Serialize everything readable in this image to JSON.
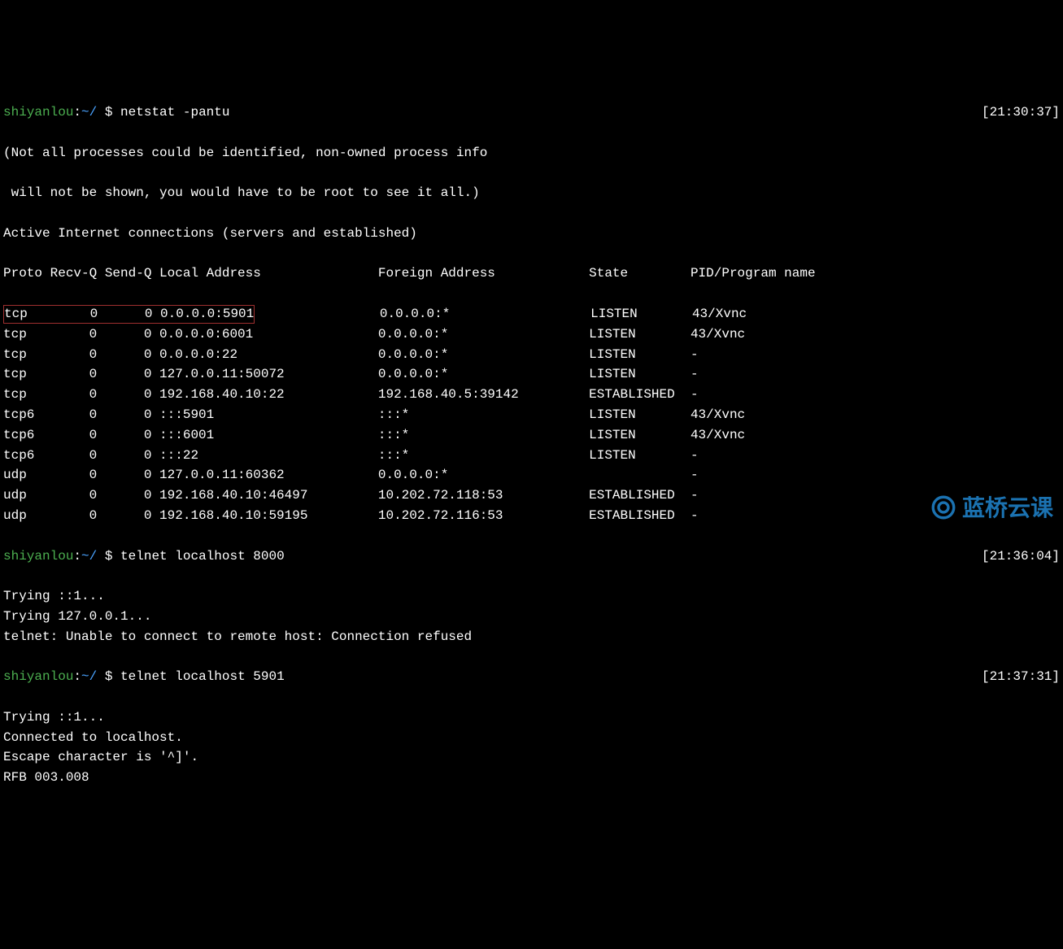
{
  "prompt1": {
    "user": "shiyanlou",
    "sep1": ":",
    "path": "~/",
    "dollar": " $ ",
    "command": "netstat -pantu",
    "timestamp": "[21:30:37]"
  },
  "warning_line1": "(Not all processes could be identified, non-owned process info",
  "warning_line2": " will not be shown, you would have to be root to see it all.)",
  "active_conn": "Active Internet connections (servers and established)",
  "header": {
    "proto": "Proto",
    "recvq": "Recv-Q",
    "sendq": "Send-Q",
    "local": "Local Address",
    "foreign": "Foreign Address",
    "state": "State",
    "pid": "PID/Program name"
  },
  "rows": [
    {
      "proto": "tcp",
      "recvq": "0",
      "sendq": "0",
      "local": "0.0.0.0:5901",
      "foreign": "0.0.0.0:*",
      "state": "LISTEN",
      "pid": "43/Xvnc",
      "highlight": true
    },
    {
      "proto": "tcp",
      "recvq": "0",
      "sendq": "0",
      "local": "0.0.0.0:6001",
      "foreign": "0.0.0.0:*",
      "state": "LISTEN",
      "pid": "43/Xvnc"
    },
    {
      "proto": "tcp",
      "recvq": "0",
      "sendq": "0",
      "local": "0.0.0.0:22",
      "foreign": "0.0.0.0:*",
      "state": "LISTEN",
      "pid": "-"
    },
    {
      "proto": "tcp",
      "recvq": "0",
      "sendq": "0",
      "local": "127.0.0.11:50072",
      "foreign": "0.0.0.0:*",
      "state": "LISTEN",
      "pid": "-"
    },
    {
      "proto": "tcp",
      "recvq": "0",
      "sendq": "0",
      "local": "192.168.40.10:22",
      "foreign": "192.168.40.5:39142",
      "state": "ESTABLISHED",
      "pid": "-"
    },
    {
      "proto": "tcp6",
      "recvq": "0",
      "sendq": "0",
      "local": ":::5901",
      "foreign": ":::*",
      "state": "LISTEN",
      "pid": "43/Xvnc"
    },
    {
      "proto": "tcp6",
      "recvq": "0",
      "sendq": "0",
      "local": ":::6001",
      "foreign": ":::*",
      "state": "LISTEN",
      "pid": "43/Xvnc"
    },
    {
      "proto": "tcp6",
      "recvq": "0",
      "sendq": "0",
      "local": ":::22",
      "foreign": ":::*",
      "state": "LISTEN",
      "pid": "-"
    },
    {
      "proto": "udp",
      "recvq": "0",
      "sendq": "0",
      "local": "127.0.0.11:60362",
      "foreign": "0.0.0.0:*",
      "state": "",
      "pid": "-"
    },
    {
      "proto": "udp",
      "recvq": "0",
      "sendq": "0",
      "local": "192.168.40.10:46497",
      "foreign": "10.202.72.118:53",
      "state": "ESTABLISHED",
      "pid": "-"
    },
    {
      "proto": "udp",
      "recvq": "0",
      "sendq": "0",
      "local": "192.168.40.10:59195",
      "foreign": "10.202.72.116:53",
      "state": "ESTABLISHED",
      "pid": "-"
    }
  ],
  "prompt2": {
    "user": "shiyanlou",
    "sep1": ":",
    "path": "~/",
    "dollar": " $ ",
    "command": "telnet localhost 8000",
    "timestamp": "[21:36:04]"
  },
  "telnet1_out": [
    "Trying ::1...",
    "Trying 127.0.0.1...",
    "telnet: Unable to connect to remote host: Connection refused"
  ],
  "prompt3": {
    "user": "shiyanlou",
    "sep1": ":",
    "path": "~/",
    "dollar": " $ ",
    "command": "telnet localhost 5901",
    "timestamp": "[21:37:31]"
  },
  "telnet2_out": [
    "Trying ::1...",
    "Connected to localhost.",
    "Escape character is '^]'.",
    "RFB 003.008"
  ],
  "watermark_text": "蓝桥云课"
}
